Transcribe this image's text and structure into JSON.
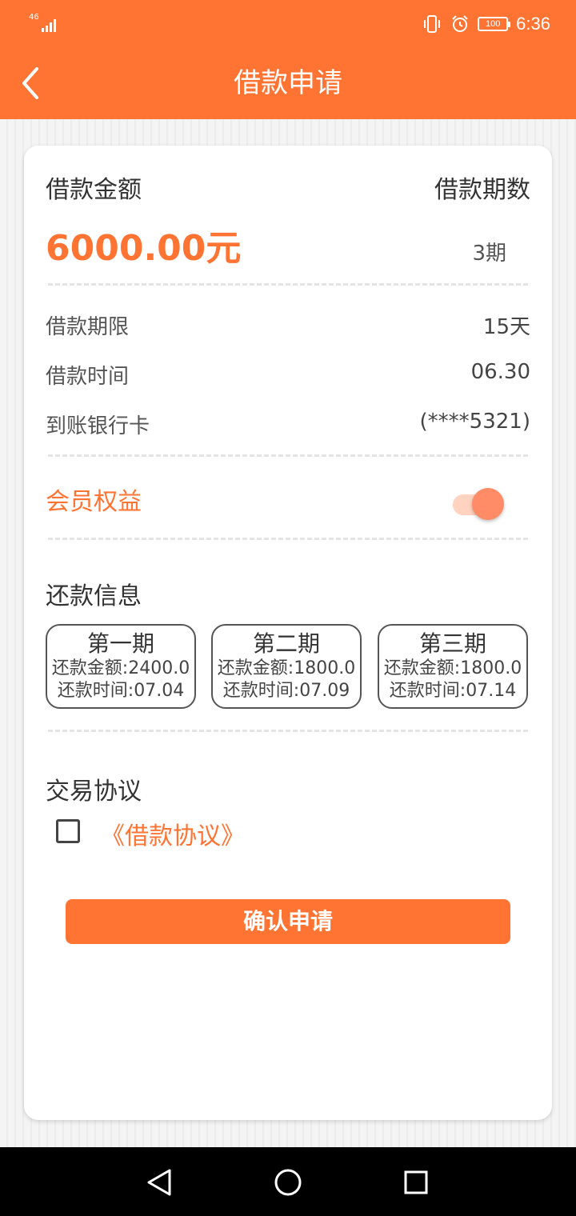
{
  "status_bar": {
    "network": "46",
    "battery": "100",
    "time": "6:36"
  },
  "app_bar": {
    "title": "借款申请"
  },
  "loan": {
    "amount_label": "借款金额",
    "amount_value": "6000.00元",
    "periods_label": "借款期数",
    "periods_value": "3期"
  },
  "details": [
    {
      "label": "借款期限",
      "value": "15天"
    },
    {
      "label": "借款时间",
      "value": "06.30"
    },
    {
      "label": "到账银行卡",
      "value": "(****5321)"
    }
  ],
  "member": {
    "label": "会员权益",
    "toggle_on": true
  },
  "repayment": {
    "title": "还款信息",
    "plans": [
      {
        "title": "第一期",
        "amount": "还款金额:2400.0",
        "date": "还款时间:07.04"
      },
      {
        "title": "第二期",
        "amount": "还款金额:1800.0",
        "date": "还款时间:07.09"
      },
      {
        "title": "第三期",
        "amount": "还款金额:1800.0",
        "date": "还款时间:07.14"
      }
    ]
  },
  "agreement": {
    "title": "交易协议",
    "link": "《借款协议》",
    "checked": false
  },
  "confirm_label": "确认申请",
  "colors": {
    "accent": "#ff7433",
    "toggle_track": "#ffd3bf",
    "toggle_thumb": "#ff8c66"
  },
  "icons": {
    "back": "chevron-left-icon",
    "nav_back": "triangle-back-icon",
    "nav_home": "circle-home-icon",
    "nav_recents": "square-recents-icon"
  }
}
